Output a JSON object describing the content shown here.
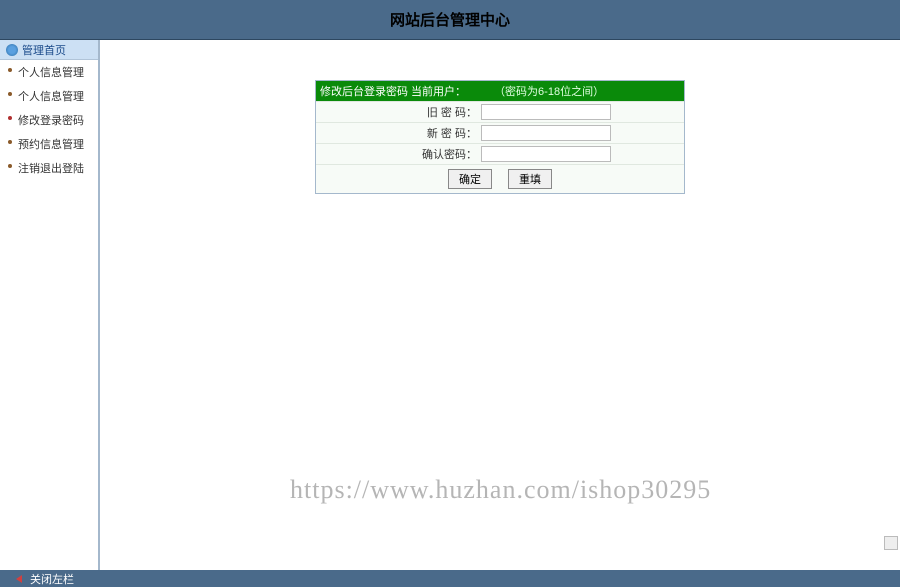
{
  "header": {
    "title": "网站后台管理中心"
  },
  "sidebar": {
    "home_label": "管理首页",
    "items": [
      {
        "label": "个人信息管理"
      },
      {
        "label": "个人信息管理"
      },
      {
        "label": "修改登录密码"
      },
      {
        "label": "预约信息管理"
      },
      {
        "label": "注销退出登陆"
      }
    ]
  },
  "form": {
    "header_prefix": "修改后台登录密码 当前用户：",
    "current_user": "",
    "hint": "（密码为6-18位之间）",
    "rows": [
      {
        "label": "旧 密 码："
      },
      {
        "label": "新 密 码："
      },
      {
        "label": "确认密码："
      }
    ],
    "submit": "确定",
    "reset": "重填"
  },
  "footer": {
    "close_label": "关闭左栏"
  },
  "watermark": "https://www.huzhan.com/ishop30295"
}
